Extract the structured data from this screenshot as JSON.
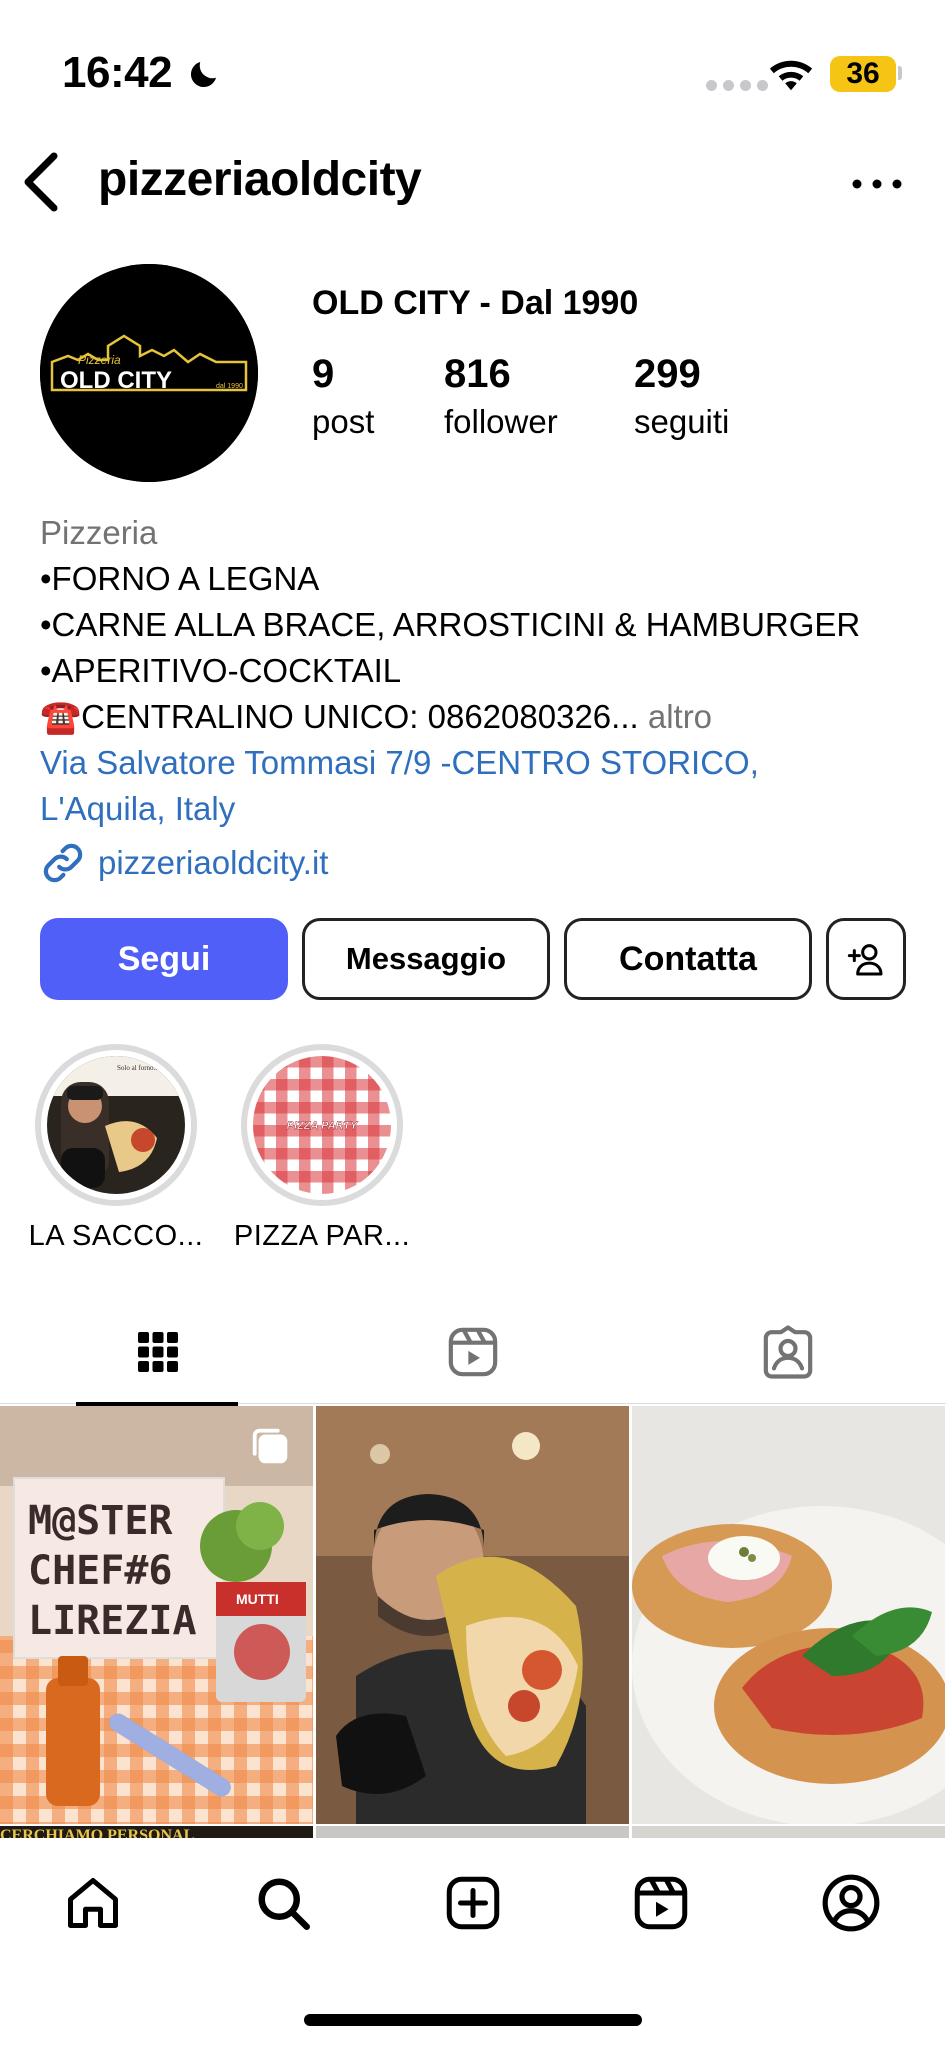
{
  "status_bar": {
    "time": "16:42",
    "battery": "36",
    "icons": [
      "moon-icon",
      "signal-icon",
      "wifi-icon",
      "battery-icon"
    ]
  },
  "header": {
    "username": "pizzeriaoldcity",
    "back_icon": "chevron-left-icon",
    "more_icon": "more-horizontal-icon"
  },
  "profile": {
    "avatar_logo_small": "Pizzeria",
    "avatar_logo_main": "OLD CITY",
    "avatar_logo_sub": "dal 1990",
    "display_name": "OLD CITY - Dal 1990",
    "stats": [
      {
        "value": "9",
        "label": "post"
      },
      {
        "value": "816",
        "label": "follower"
      },
      {
        "value": "299",
        "label": "seguiti"
      }
    ]
  },
  "bio": {
    "category": "Pizzeria",
    "lines": [
      "•FORNO A LEGNA",
      "•CARNE ALLA BRACE, ARROSTICINI & HAMBURGER",
      "•APERITIVO-COCKTAIL"
    ],
    "phone_line": "☎️CENTRALINO UNICO: 0862080326...",
    "more_label": "altro",
    "address_line1": "Via Salvatore Tommasi 7/9 -CENTRO STORICO,",
    "address_line2": "L'Aquila, Italy",
    "website": "pizzeriaoldcity.it"
  },
  "actions": {
    "follow": "Segui",
    "message": "Messaggio",
    "contact": "Contatta",
    "add_user_icon": "person-add-icon"
  },
  "highlights": [
    {
      "label": "LA SACCO...",
      "cover_text": "Solo al forno..."
    },
    {
      "label": "PIZZA PAR...",
      "cover_text": "PIZZA PARTY"
    }
  ],
  "tabs": [
    {
      "name": "grid",
      "icon": "grid-icon",
      "active": true
    },
    {
      "name": "reels",
      "icon": "reels-icon",
      "active": false
    },
    {
      "name": "tagged",
      "icon": "tagged-icon",
      "active": false
    }
  ],
  "posts": [
    {
      "description": "Master Chef #6 sign on checkered table",
      "sign_line1": "M@STER",
      "sign_line2": "CHEF#6",
      "sign_line3": "LIREZIA",
      "can_label": "MUTTI",
      "multi_icon": "carousel-icon"
    },
    {
      "description": "Chef holding a pizza sandwich"
    },
    {
      "description": "Fried pizzas with mortadella and burrata"
    }
  ],
  "second_row_caption": "CERCHIAMO PERSONAL",
  "bottom_nav": [
    {
      "name": "home",
      "icon": "home-icon"
    },
    {
      "name": "search",
      "icon": "search-icon"
    },
    {
      "name": "create",
      "icon": "plus-square-icon"
    },
    {
      "name": "reels",
      "icon": "reels-icon"
    },
    {
      "name": "profile",
      "icon": "profile-icon"
    }
  ]
}
